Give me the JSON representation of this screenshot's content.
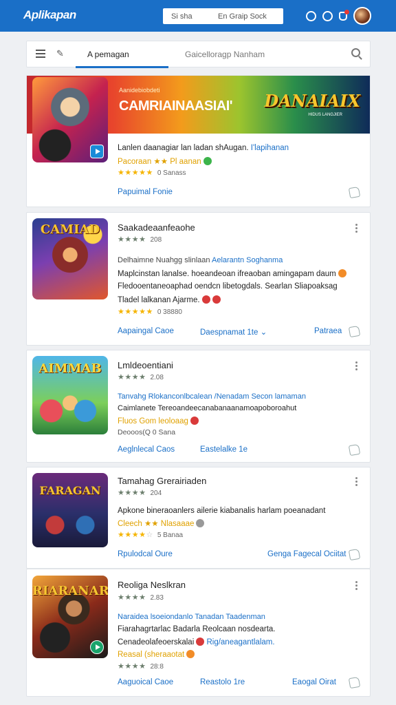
{
  "header": {
    "brand": "Aplikapan",
    "search_left": "Si sha",
    "search_right": "En Graip Sock"
  },
  "tabbar": {
    "active_tab": "A pemagan",
    "search_placeholder": "Gaicelloragp Nanham"
  },
  "featured": {
    "banner_sub": "Aanidebiobdeti",
    "banner_title": "CAMRIAINAASIAI'",
    "banner_logo": "DANAIAIX",
    "banner_logo_sub": "HIDUS LANGJIER",
    "line1": "Lanlen daanagiar  lan ladan shAugan.",
    "line1_link": "I'lapihanan",
    "line2": "Pacoraan  ★★  Pl aanan",
    "rating_count": "0 Sanass",
    "link": "Papuimal  Fonie"
  },
  "cards": [
    {
      "title": "Saakadeaanfeaohe",
      "rating_count": "208",
      "desc_blue_prefix": "Delhaimne Nuahgg slinlaan",
      "desc_blue_suffix": "Aelarantn Soghanma",
      "desc1": "Maplcinstan lanalse. hoeandeoan ifreaoban amingapam daum",
      "desc2": "Fledooentaneoaphad oendcn libetogdals. Searlan Sliapoaksag",
      "desc3": "Tladel lalkanan Ajarme.",
      "rating_count2": "0 38880",
      "link_left": "Aapaingal  Caoe",
      "link_mid": "Daespnamat  1te",
      "link_right": "Patraea"
    },
    {
      "title": "Lmldeoentiani",
      "rating_count": "2.08",
      "desc_blue": "Tanvahg Rlokanconlbcalean /Nenadam Secon lamaman",
      "desc1": "Caimlanete Tereoandeecanabanaanamoapoboroahut",
      "desc2": "Fluos  Gom leoloaag",
      "desc3": "Deooos(Q 0 Sana",
      "link_left": "Aeglnlecal  Caos",
      "link_mid": "Eastelalke  1e"
    },
    {
      "title": "Tamahag Grerairiaden",
      "rating_count": "204",
      "desc1": "Apkone  bineraoanlers ailerie kiabanalis harlam poeanadant",
      "desc2": "Cleech  ★★  Nlasaaae",
      "rating_count2": "5 Banaa",
      "link_left": "Rpulodcal  Oure",
      "link_right": "Genga Fagecal  Ociitat"
    },
    {
      "title": "Reoliga Neslkran",
      "rating_count": "2.83",
      "desc_blue": "Naraidea  lsoeiondanlo Tanadan Taadenman",
      "desc1": "Fiarahagrtarlac Badarla Reolcaan nosdearta.",
      "desc2": "Cenadeolafeoerskalai",
      "desc2_blue": "Rig/aneagantlalam.",
      "desc3": "Reasal (sheraaotat",
      "rating_count2": "28:8",
      "link_left": "Aaguoical  Caoe",
      "link_mid": "Reastolo  1re",
      "link_right": "Eaogal  Oirat"
    }
  ],
  "thumb_labels": [
    "CAMIAD",
    "AIMMAB",
    "FARAGAN",
    "RIARANAR"
  ],
  "colors": {
    "header": "#1a6fc7",
    "link": "#1a6fc7",
    "star": "#f5b400"
  }
}
